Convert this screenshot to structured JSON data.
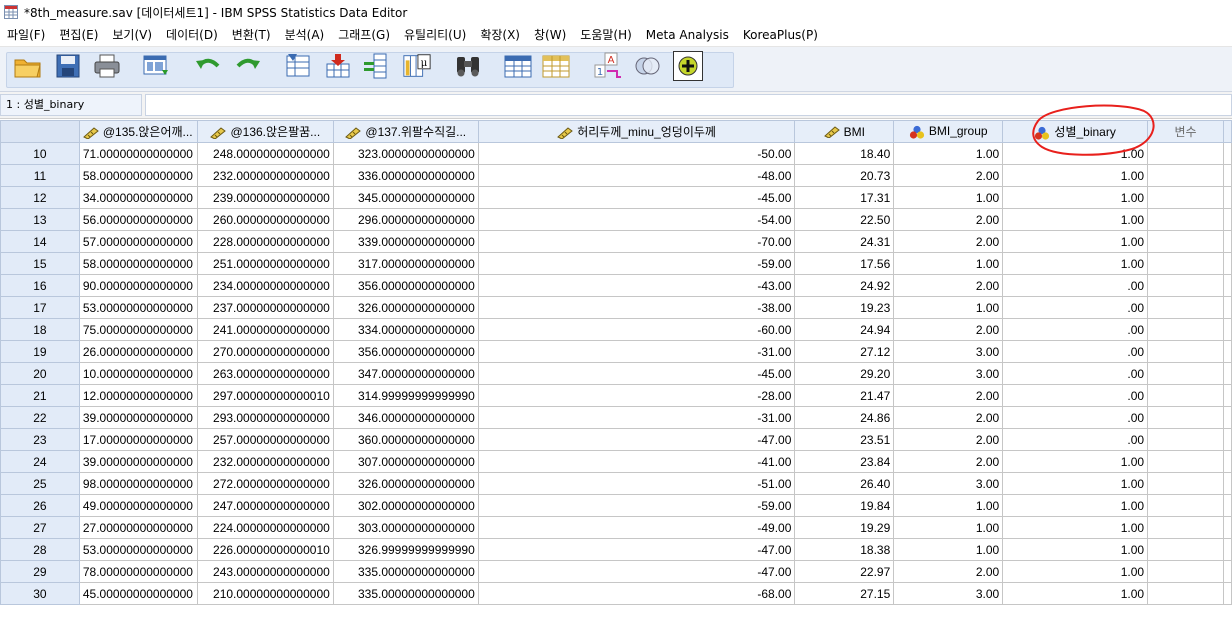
{
  "window": {
    "title": "*8th_measure.sav [데이터세트1] - IBM SPSS Statistics Data Editor",
    "app_icon": "spss-data-editor-icon"
  },
  "menu": [
    {
      "label": "파일(F)"
    },
    {
      "label": "편집(E)"
    },
    {
      "label": "보기(V)"
    },
    {
      "label": "데이터(D)"
    },
    {
      "label": "변환(T)"
    },
    {
      "label": "분석(A)"
    },
    {
      "label": "그래프(G)"
    },
    {
      "label": "유틸리티(U)"
    },
    {
      "label": "확장(X)"
    },
    {
      "label": "창(W)"
    },
    {
      "label": "도움말(H)"
    },
    {
      "label": "Meta Analysis"
    },
    {
      "label": "KoreaPlus(P)"
    }
  ],
  "toolbar": {
    "buttons": [
      {
        "icon": "open-folder-icon"
      },
      {
        "icon": "save-icon"
      },
      {
        "icon": "print-icon"
      },
      {
        "icon": "recall-dialog-icon"
      },
      {
        "icon": "undo-icon"
      },
      {
        "icon": "redo-icon"
      },
      {
        "icon": "goto-case-icon"
      },
      {
        "icon": "goto-variable-icon"
      },
      {
        "icon": "variables-icon"
      },
      {
        "icon": "run-descriptives-icon"
      },
      {
        "icon": "find-icon"
      },
      {
        "icon": "insert-cases-icon"
      },
      {
        "icon": "insert-variable-icon"
      },
      {
        "icon": "split-file-icon"
      },
      {
        "icon": "select-cases-icon"
      },
      {
        "icon": "value-labels-icon"
      },
      {
        "icon": "use-sets-icon"
      }
    ]
  },
  "locator": {
    "cell_ref": "1 : 성별_binary",
    "cell_value": ""
  },
  "grid": {
    "columns": [
      {
        "label": "@135.앉은어깨...",
        "icon": "scale-ruler-icon"
      },
      {
        "label": "@136.앉은팔꿈...",
        "icon": "scale-ruler-icon"
      },
      {
        "label": "@137.위팔수직길...",
        "icon": "scale-ruler-icon"
      },
      {
        "label": "허리두께_minu_엉덩이두께",
        "icon": "scale-ruler-icon"
      },
      {
        "label": "BMI",
        "icon": "scale-ruler-icon"
      },
      {
        "label": "BMI_group",
        "icon": "nominal-circles-icon"
      },
      {
        "label": "성별_binary",
        "icon": "nominal-circles-icon"
      },
      {
        "label": "변수",
        "icon": ""
      }
    ],
    "rows": [
      {
        "n": "10",
        "c": [
          "71.00000000000000",
          "248.00000000000000",
          "323.00000000000000",
          "-50.00",
          "18.40",
          "1.00",
          "1.00",
          ""
        ]
      },
      {
        "n": "11",
        "c": [
          "58.00000000000000",
          "232.00000000000000",
          "336.00000000000000",
          "-48.00",
          "20.73",
          "2.00",
          "1.00",
          ""
        ]
      },
      {
        "n": "12",
        "c": [
          "34.00000000000000",
          "239.00000000000000",
          "345.00000000000000",
          "-45.00",
          "17.31",
          "1.00",
          "1.00",
          ""
        ]
      },
      {
        "n": "13",
        "c": [
          "56.00000000000000",
          "260.00000000000000",
          "296.00000000000000",
          "-54.00",
          "22.50",
          "2.00",
          "1.00",
          ""
        ]
      },
      {
        "n": "14",
        "c": [
          "57.00000000000000",
          "228.00000000000000",
          "339.00000000000000",
          "-70.00",
          "24.31",
          "2.00",
          "1.00",
          ""
        ]
      },
      {
        "n": "15",
        "c": [
          "58.00000000000000",
          "251.00000000000000",
          "317.00000000000000",
          "-59.00",
          "17.56",
          "1.00",
          "1.00",
          ""
        ]
      },
      {
        "n": "16",
        "c": [
          "90.00000000000000",
          "234.00000000000000",
          "356.00000000000000",
          "-43.00",
          "24.92",
          "2.00",
          ".00",
          ""
        ]
      },
      {
        "n": "17",
        "c": [
          "53.00000000000000",
          "237.00000000000000",
          "326.00000000000000",
          "-38.00",
          "19.23",
          "1.00",
          ".00",
          ""
        ]
      },
      {
        "n": "18",
        "c": [
          "75.00000000000000",
          "241.00000000000000",
          "334.00000000000000",
          "-60.00",
          "24.94",
          "2.00",
          ".00",
          ""
        ]
      },
      {
        "n": "19",
        "c": [
          "26.00000000000000",
          "270.00000000000000",
          "356.00000000000000",
          "-31.00",
          "27.12",
          "3.00",
          ".00",
          ""
        ]
      },
      {
        "n": "20",
        "c": [
          "10.00000000000000",
          "263.00000000000000",
          "347.00000000000000",
          "-45.00",
          "29.20",
          "3.00",
          ".00",
          ""
        ]
      },
      {
        "n": "21",
        "c": [
          "12.00000000000000",
          "297.00000000000010",
          "314.99999999999990",
          "-28.00",
          "21.47",
          "2.00",
          ".00",
          ""
        ]
      },
      {
        "n": "22",
        "c": [
          "39.00000000000000",
          "293.00000000000000",
          "346.00000000000000",
          "-31.00",
          "24.86",
          "2.00",
          ".00",
          ""
        ]
      },
      {
        "n": "23",
        "c": [
          "17.00000000000000",
          "257.00000000000000",
          "360.00000000000000",
          "-47.00",
          "23.51",
          "2.00",
          ".00",
          ""
        ]
      },
      {
        "n": "24",
        "c": [
          "39.00000000000000",
          "232.00000000000000",
          "307.00000000000000",
          "-41.00",
          "23.84",
          "2.00",
          "1.00",
          ""
        ]
      },
      {
        "n": "25",
        "c": [
          "98.00000000000000",
          "272.00000000000000",
          "326.00000000000000",
          "-51.00",
          "26.40",
          "3.00",
          "1.00",
          ""
        ]
      },
      {
        "n": "26",
        "c": [
          "49.00000000000000",
          "247.00000000000000",
          "302.00000000000000",
          "-59.00",
          "19.84",
          "1.00",
          "1.00",
          ""
        ]
      },
      {
        "n": "27",
        "c": [
          "27.00000000000000",
          "224.00000000000000",
          "303.00000000000000",
          "-49.00",
          "19.29",
          "1.00",
          "1.00",
          ""
        ]
      },
      {
        "n": "28",
        "c": [
          "53.00000000000000",
          "226.00000000000010",
          "326.99999999999990",
          "-47.00",
          "18.38",
          "1.00",
          "1.00",
          ""
        ]
      },
      {
        "n": "29",
        "c": [
          "78.00000000000000",
          "243.00000000000000",
          "335.00000000000000",
          "-47.00",
          "22.97",
          "2.00",
          "1.00",
          ""
        ]
      },
      {
        "n": "30",
        "c": [
          "45.00000000000000",
          "210.00000000000000",
          "335.00000000000000",
          "-68.00",
          "27.15",
          "3.00",
          "1.00",
          ""
        ]
      }
    ]
  },
  "colors": {
    "header_bg": "#e6eef9",
    "rownum_bg": "#e2ebf8",
    "annotation": "#e8201c"
  }
}
